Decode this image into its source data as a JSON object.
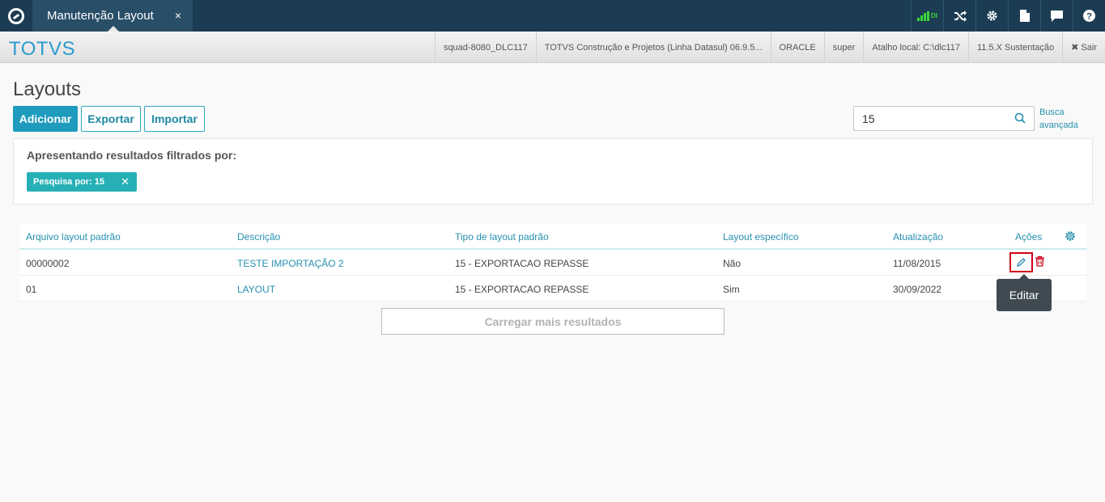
{
  "topbar": {
    "tab_title": "Manutenção Layout",
    "tab_close": "×",
    "signal_label": "DI"
  },
  "header": {
    "brand": "TOTVS",
    "env": [
      "squad-8080_DLC117",
      "TOTVS Construção e Projetos (Linha Datasul) 06.9.5...",
      "ORACLE",
      "super",
      "Atalho local: C:\\dlc117",
      "11.5.X Sustentação"
    ],
    "logout": "✖ Sair"
  },
  "page": {
    "title": "Layouts",
    "buttons": {
      "add": "Adicionar",
      "export": "Exportar",
      "import": "Importar"
    },
    "search_value": "15",
    "advanced_search": "Busca avançada"
  },
  "filter": {
    "title": "Apresentando resultados filtrados por:",
    "chip": "Pesquisa por: 15",
    "chip_close": "✕"
  },
  "table": {
    "columns": [
      "Arquivo layout padrão",
      "Descrição",
      "Tipo de layout padrão",
      "Layout específico",
      "Atualização",
      "Ações"
    ],
    "rows": [
      [
        "00000002",
        "TESTE IMPORTAÇÃO 2",
        "15 - EXPORTACAO REPASSE",
        "Não",
        "11/08/2015"
      ],
      [
        "01",
        "LAYOUT",
        "15 - EXPORTACAO REPASSE",
        "Sim",
        "30/09/2022"
      ]
    ]
  },
  "load_more": "Carregar mais resultados",
  "tooltip": "Editar",
  "colors": {
    "topbar": "#1b3c53",
    "accent": "#2b9ccc",
    "chip": "#26b0b6",
    "highlight": "#d0021b"
  }
}
